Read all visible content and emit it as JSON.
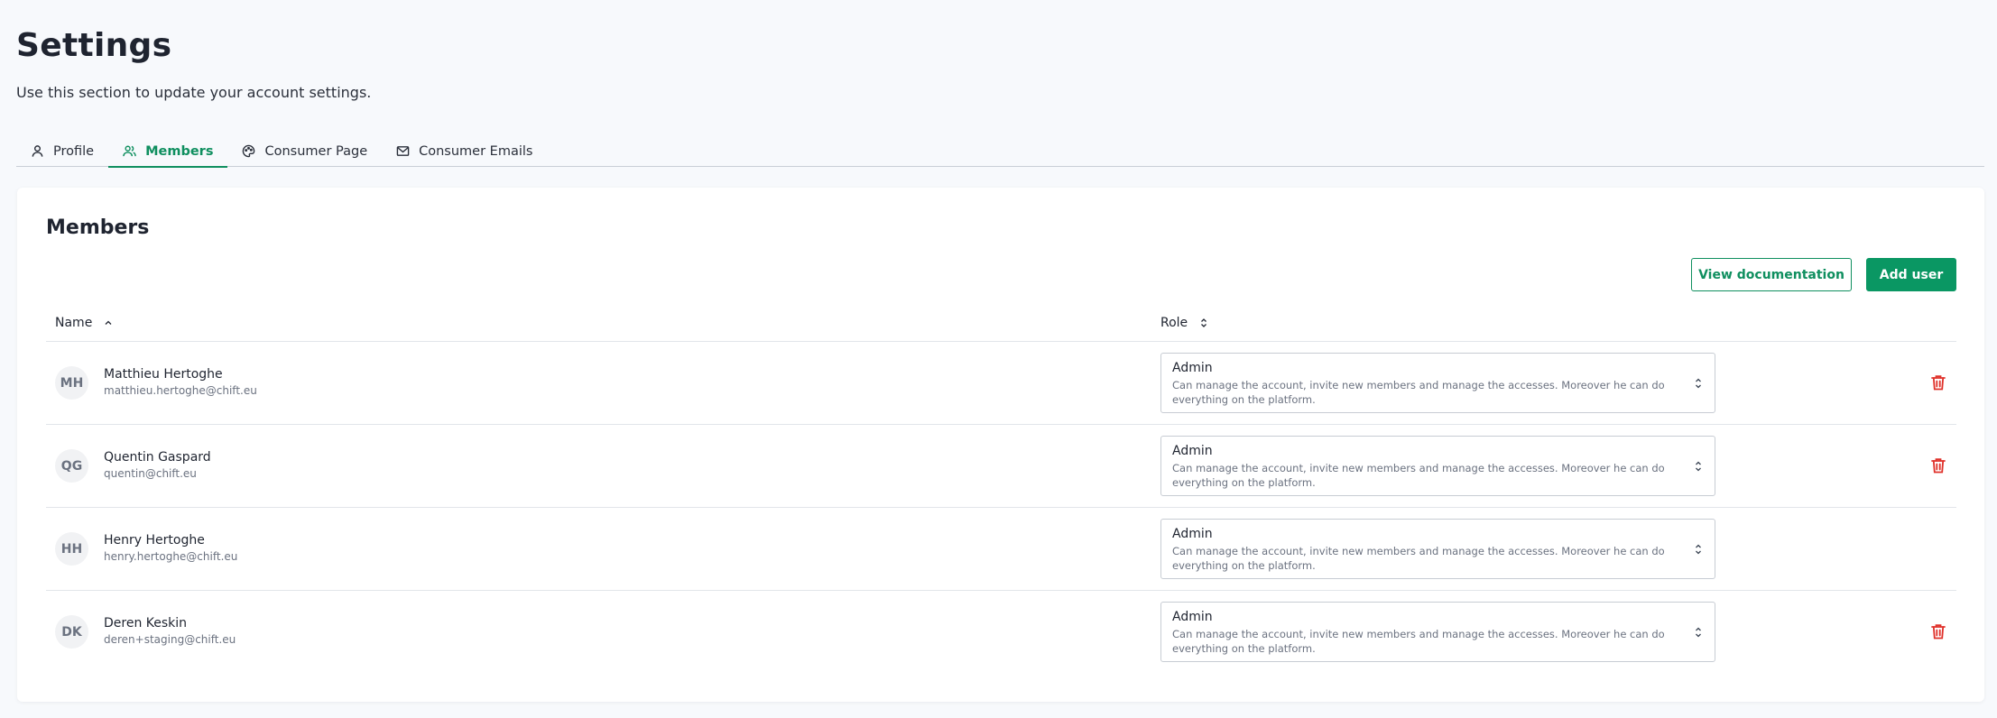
{
  "page": {
    "title": "Settings",
    "subtitle": "Use this section to update your account settings."
  },
  "tabs": [
    {
      "label": "Profile",
      "icon": "user-icon",
      "active": false
    },
    {
      "label": "Members",
      "icon": "users-icon",
      "active": true
    },
    {
      "label": "Consumer Page",
      "icon": "palette-icon",
      "active": false
    },
    {
      "label": "Consumer Emails",
      "icon": "mail-icon",
      "active": false
    }
  ],
  "members": {
    "title": "Members",
    "view_docs_label": "View documentation",
    "add_user_label": "Add user",
    "columns": {
      "name": "Name",
      "role": "Role"
    },
    "rows": [
      {
        "initials": "MH",
        "name": "Matthieu Hertoghe",
        "email": "matthieu.hertoghe@chift.eu",
        "role": "Admin",
        "role_desc": "Can manage the account, invite new members and manage the accesses. Moreover he can do everything on the platform.",
        "deletable": true
      },
      {
        "initials": "QG",
        "name": "Quentin Gaspard",
        "email": "quentin@chift.eu",
        "role": "Admin",
        "role_desc": "Can manage the account, invite new members and manage the accesses. Moreover he can do everything on the platform.",
        "deletable": true
      },
      {
        "initials": "HH",
        "name": "Henry Hertoghe",
        "email": "henry.hertoghe@chift.eu",
        "role": "Admin",
        "role_desc": "Can manage the account, invite new members and manage the accesses. Moreover he can do everything on the platform.",
        "deletable": false
      },
      {
        "initials": "DK",
        "name": "Deren Keskin",
        "email": "deren+staging@chift.eu",
        "role": "Admin",
        "role_desc": "Can manage the account, invite new members and manage the accesses. Moreover he can do everything on the platform.",
        "deletable": true
      }
    ]
  },
  "colors": {
    "accent": "#0f8f5f",
    "primary_button": "#0a9763",
    "danger": "#e0322b",
    "background": "#f7f9fc"
  }
}
